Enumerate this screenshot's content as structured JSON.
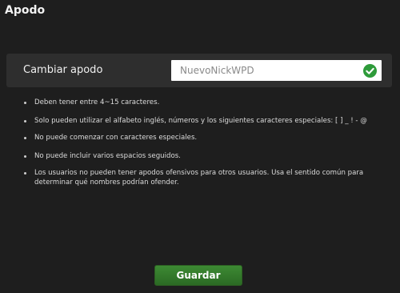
{
  "header": {
    "title": "Apodo"
  },
  "nickname": {
    "label": "Cambiar apodo",
    "value": "NuevoNickWPD",
    "status_icon": "check-circle-icon",
    "status_color": "#2e9b3a"
  },
  "rules": [
    "Deben tener entre 4~15 caracteres.",
    "Solo pueden utilizar el alfabeto inglés, números y los siguientes caracteres especiales: [ ] _ ! - @",
    "No puede comenzar con caracteres especiales.",
    "No puede incluir varios espacios seguidos.",
    "Los usuarios no pueden tener apodos ofensivos para otros usuarios. Usa el sentido común para determinar qué nombres podrían ofender."
  ],
  "actions": {
    "save_label": "Guardar"
  }
}
